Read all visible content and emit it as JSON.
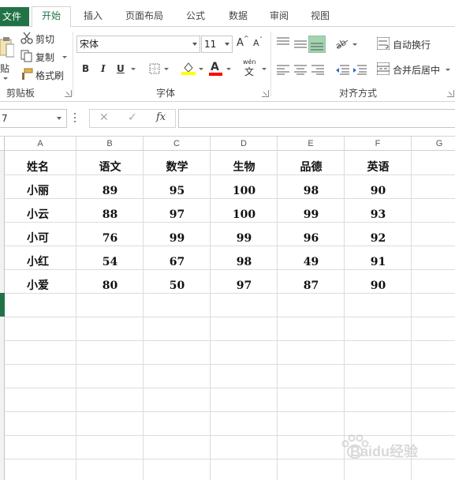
{
  "tabs": {
    "file": "文件",
    "items": [
      {
        "label": "开始",
        "active": true
      },
      {
        "label": "插入",
        "active": false
      },
      {
        "label": "页面布局",
        "active": false
      },
      {
        "label": "公式",
        "active": false
      },
      {
        "label": "数据",
        "active": false
      },
      {
        "label": "审阅",
        "active": false
      },
      {
        "label": "视图",
        "active": false
      }
    ]
  },
  "clipboard": {
    "paste_label": "贴",
    "cut": "剪切",
    "copy": "复制",
    "format_painter": "格式刷",
    "group_label": "剪贴板"
  },
  "font": {
    "name": "宋体",
    "size": "11",
    "bold": "B",
    "italic": "I",
    "underline": "U",
    "font_color_glyph": "A",
    "phonetic_top": "wén",
    "phonetic_glyph": "文",
    "group_label": "字体"
  },
  "alignment": {
    "wrap_text": "自动换行",
    "merge_center": "合并后居中",
    "group_label": "对齐方式"
  },
  "formula_bar": {
    "name_box": "7",
    "cancel": "✕",
    "enter": "✓",
    "fx": "fx",
    "value": ""
  },
  "sheet": {
    "columns": [
      "A",
      "B",
      "C",
      "D",
      "E",
      "F",
      "G"
    ],
    "header": [
      "姓名",
      "语文",
      "数学",
      "生物",
      "品德",
      "英语"
    ],
    "rows": [
      [
        "小丽",
        "89",
        "95",
        "100",
        "98",
        "90"
      ],
      [
        "小云",
        "88",
        "97",
        "100",
        "99",
        "93"
      ],
      [
        "小可",
        "76",
        "99",
        "99",
        "96",
        "92"
      ],
      [
        "小红",
        "54",
        "67",
        "98",
        "49",
        "91"
      ],
      [
        "小爱",
        "80",
        "50",
        "97",
        "87",
        "90"
      ]
    ]
  },
  "watermark": {
    "text": "Baidu经验"
  },
  "colors": {
    "accent": "#217346",
    "highlight": "#ffff00",
    "font_red": "#ff0000"
  }
}
